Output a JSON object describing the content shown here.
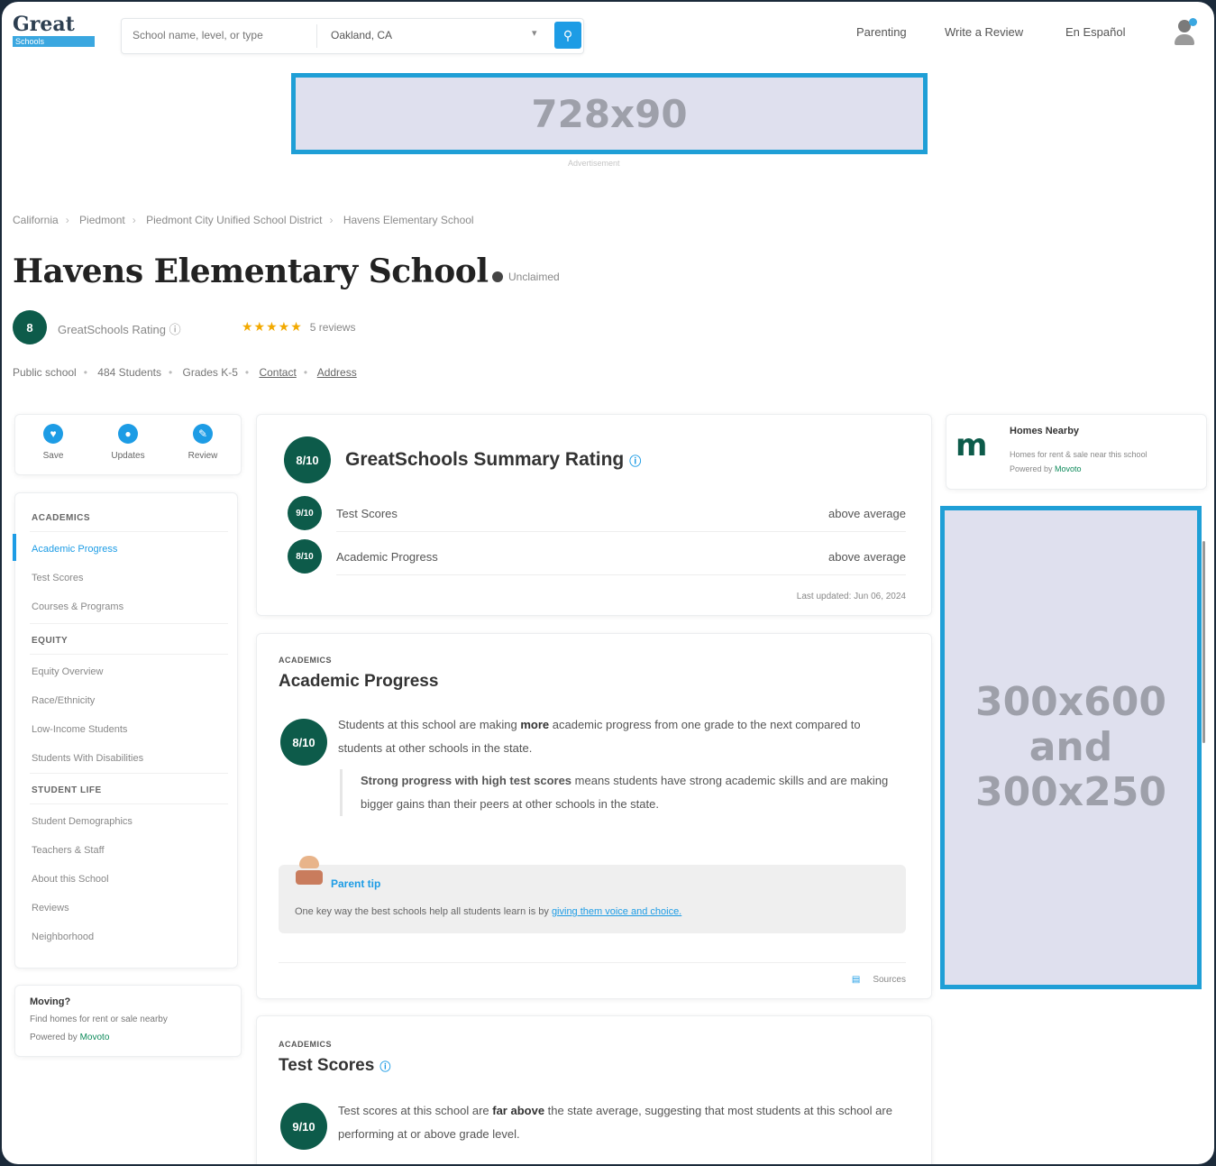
{
  "header": {
    "logo_top": "Great",
    "logo_bottom": "Schools",
    "search_placeholder": "School name, level, or type",
    "location_value": "Oakland, CA",
    "nav": [
      "Parenting",
      "Write a Review",
      "En Español"
    ]
  },
  "ads": {
    "top": "728x90",
    "top_caption": "Advertisement",
    "side_line1": "300x600",
    "side_line2": "and",
    "side_line3": "300x250"
  },
  "breadcrumbs": [
    "California",
    "Piedmont",
    "Piedmont City Unified School District",
    "Havens Elementary School"
  ],
  "school": {
    "name": "Havens Elementary School",
    "claimed": "Unclaimed",
    "rating": "8",
    "rating_label": "GreatSchools Rating ⓘ",
    "stars": "★★★★★",
    "reviews": "5 reviews",
    "facts": [
      "Public school",
      "484 Students",
      "Grades K-5",
      "Contact",
      "Address"
    ]
  },
  "quick_actions": [
    "Save",
    "Updates",
    "Review"
  ],
  "toc": {
    "sections": [
      {
        "head": "ACADEMICS",
        "items": [
          "Academic Progress",
          "Test Scores",
          "Courses & Programs"
        ]
      },
      {
        "head": "EQUITY",
        "items": [
          "Equity Overview",
          "Race/Ethnicity",
          "Low-Income Students",
          "Students With Disabilities"
        ]
      },
      {
        "head": "STUDENT LIFE",
        "items": [
          "Student Demographics",
          "Teachers & Staff",
          "About this School",
          "Reviews",
          "Neighborhood"
        ]
      }
    ]
  },
  "moving": {
    "title": "Moving?",
    "text": "Find homes for rent or sale nearby",
    "powered": "Powered by",
    "partner": "Movoto"
  },
  "summary": {
    "rating": "8/10",
    "title": "GreatSchools Summary Rating",
    "rows": [
      {
        "badge": "9/10",
        "label": "Test Scores",
        "value": "above average"
      },
      {
        "badge": "8/10",
        "label": "Academic Progress",
        "value": "above average"
      }
    ],
    "updated": "Last updated: Jun 06, 2024"
  },
  "academic": {
    "caption": "ACADEMICS",
    "title": "Academic Progress",
    "badge": "8/10",
    "text_pre": "Students at this school are making ",
    "text_bold": "more",
    "text_post": " academic progress from one grade to the next compared to students at other schools in the state.",
    "quote_bold": "Strong progress with high test scores",
    "quote_rest": " means students have strong academic skills and are making bigger gains than their peers at other schools in the state.",
    "tip_label": "Parent tip",
    "tip_text": "One key way the best schools help all students learn is by",
    "tip_link": "giving them voice and choice.",
    "sources": "Sources"
  },
  "testscores": {
    "caption": "ACADEMICS",
    "title": "Test Scores",
    "badge": "9/10",
    "text_pre": "Test scores at this school are ",
    "text_bold": "far above",
    "text_post": " the state average, suggesting that most students at this school are performing at or above grade level."
  },
  "nearby": {
    "title": "Homes Nearby",
    "text": "Homes for rent & sale near this school",
    "powered": "Powered by",
    "partner": "Movoto"
  },
  "colors": {
    "brand_green": "#0d5b4a",
    "accent_blue": "#1d9ce5",
    "star": "#f2a900"
  }
}
